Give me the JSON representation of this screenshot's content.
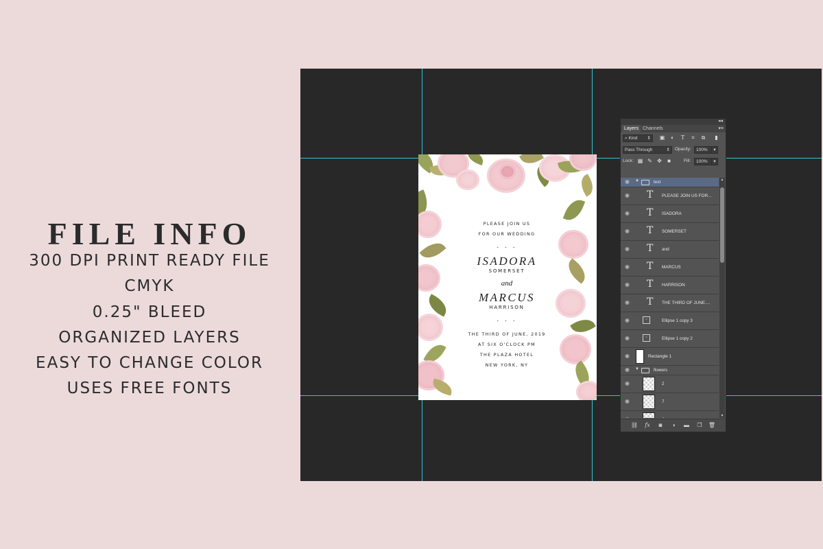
{
  "info": {
    "title": "FILE INFO",
    "items": [
      "300 DPI PRINT READY FILE",
      "CMYK",
      "0.25\" BLEED",
      "ORGANIZED LAYERS",
      "EASY TO CHANGE COLOR",
      "USES FREE FONTS"
    ]
  },
  "invitation": {
    "line1": "PLEASE JOIN US",
    "line2": "FOR OUR WEDDING",
    "dots": ". . .",
    "name1": "ISADORA",
    "surname1": "SOMERSET",
    "and": "and",
    "name2": "MARCUS",
    "surname2": "HARRISON",
    "dots2": ". . .",
    "date": "THE THIRD OF JUNE, 2019",
    "time": "AT SIX O'CLOCK PM",
    "venue": "THE PLAZA HOTEL",
    "city": "NEW YORK, NY"
  },
  "panel": {
    "tabs": [
      "Layers",
      "Channels"
    ],
    "filter_kind": "Kind",
    "blend_mode": "Pass Through",
    "opacity_label": "Opacity:",
    "opacity_value": "100%",
    "lock_label": "Lock:",
    "fill_label": "Fill:",
    "fill_value": "100%",
    "layers": [
      {
        "type": "group",
        "name": "text",
        "selected": true
      },
      {
        "type": "text",
        "name": "PLEASE JOIN US FOR..."
      },
      {
        "type": "text",
        "name": "ISADORA"
      },
      {
        "type": "text",
        "name": "SOMERSET"
      },
      {
        "type": "text",
        "name": "and"
      },
      {
        "type": "text",
        "name": "MARCUS"
      },
      {
        "type": "text",
        "name": "HARRISON"
      },
      {
        "type": "text",
        "name": "THE THIRD OF JUNE...."
      },
      {
        "type": "shape",
        "name": "Ellipse 1 copy 3"
      },
      {
        "type": "shape",
        "name": "Ellipse 1 copy 2"
      },
      {
        "type": "rect",
        "name": "Rectangle 1"
      },
      {
        "type": "group",
        "name": "flowers",
        "selected": false
      },
      {
        "type": "image",
        "name": "2"
      },
      {
        "type": "image",
        "name": "7"
      },
      {
        "type": "image",
        "name": "6"
      }
    ]
  },
  "colors": {
    "background": "#ecdadb",
    "canvas": "#282828",
    "guide": "#33c7d6",
    "panel": "#535353",
    "selected_layer": "#5a6a86"
  }
}
